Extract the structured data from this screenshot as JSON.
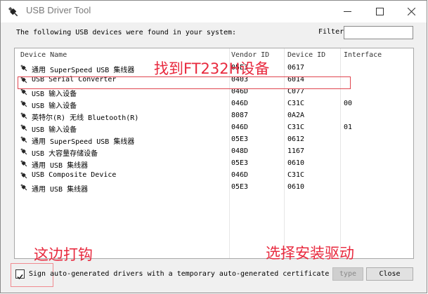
{
  "window": {
    "title": "USB Driver Tool",
    "controls": [
      "minimize-icon",
      "maximize-icon",
      "close-icon"
    ]
  },
  "header": {
    "description": "The following USB devices were found in your system:",
    "filter_label": "Filter",
    "filter_value": ""
  },
  "table": {
    "columns": [
      "Device Name",
      "Vendor ID",
      "Device ID",
      "Interface"
    ],
    "rows": [
      {
        "name": "通用 SuperSpeed USB 集线器",
        "vendor": "05E3",
        "device": "0617",
        "interface": ""
      },
      {
        "name": "USB Serial Converter",
        "vendor": "0403",
        "device": "6014",
        "interface": ""
      },
      {
        "name": "USB 输入设备",
        "vendor": "046D",
        "device": "C077",
        "interface": ""
      },
      {
        "name": "USB 输入设备",
        "vendor": "046D",
        "device": "C31C",
        "interface": "00"
      },
      {
        "name": "英特尔(R) 无线 Bluetooth(R)",
        "vendor": "8087",
        "device": "0A2A",
        "interface": ""
      },
      {
        "name": "USB 输入设备",
        "vendor": "046D",
        "device": "C31C",
        "interface": "01"
      },
      {
        "name": "通用 SuperSpeed USB 集线器",
        "vendor": "05E3",
        "device": "0612",
        "interface": ""
      },
      {
        "name": "USB 大容量存储设备",
        "vendor": "048D",
        "device": "1167",
        "interface": ""
      },
      {
        "name": "通用 USB 集线器",
        "vendor": "05E3",
        "device": "0610",
        "interface": ""
      },
      {
        "name": "USB Composite Device",
        "vendor": "046D",
        "device": "C31C",
        "interface": ""
      },
      {
        "name": "通用 USB 集线器",
        "vendor": "05E3",
        "device": "0610",
        "interface": ""
      }
    ]
  },
  "annotations": {
    "find_device": "找到FT232H设备",
    "check_here": "这边打钩",
    "select_install": "选择安装驱动"
  },
  "footer": {
    "sign_label": "Sign auto-generated drivers with a temporary auto-generated certificate",
    "sign_checked": true,
    "type_button": "type",
    "close_button": "Close"
  },
  "colors": {
    "annotation_red": "#e8293e",
    "highlight_border": "#e0454f"
  }
}
